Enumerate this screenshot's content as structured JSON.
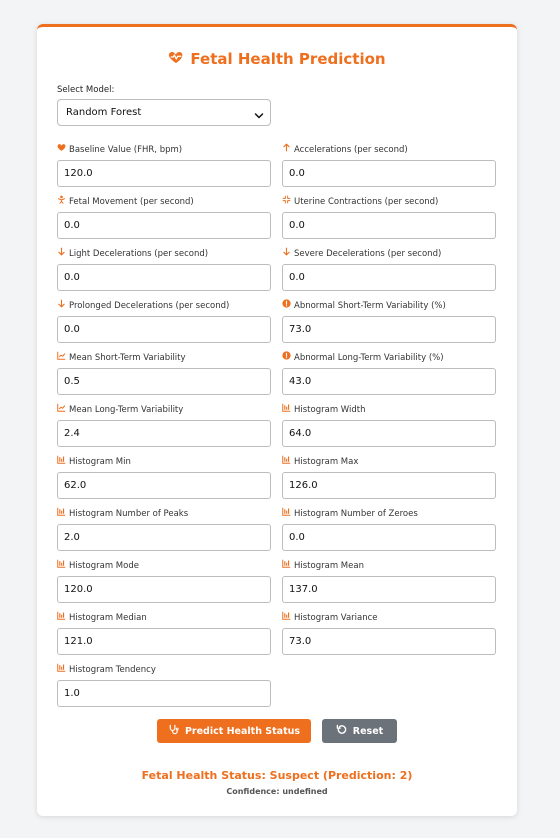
{
  "header": {
    "title": "Fetal Health Prediction"
  },
  "model": {
    "label": "Select Model:",
    "value": "Random Forest"
  },
  "fields": [
    {
      "label": "Baseline Value (FHR, bpm)",
      "value": "120.0",
      "icon": "heart-icon"
    },
    {
      "label": "Accelerations (per second)",
      "value": "0.0",
      "icon": "arrow-up-icon"
    },
    {
      "label": "Fetal Movement (per second)",
      "value": "0.0",
      "icon": "baby-icon"
    },
    {
      "label": "Uterine Contractions (per second)",
      "value": "0.0",
      "icon": "compress-icon"
    },
    {
      "label": "Light Decelerations (per second)",
      "value": "0.0",
      "icon": "arrow-down-icon"
    },
    {
      "label": "Severe Decelerations (per second)",
      "value": "0.0",
      "icon": "arrow-down-icon"
    },
    {
      "label": "Prolonged Decelerations (per second)",
      "value": "0.0",
      "icon": "arrow-down-icon"
    },
    {
      "label": "Abnormal Short-Term Variability (%)",
      "value": "73.0",
      "icon": "alert-circle-icon"
    },
    {
      "label": "Mean Short-Term Variability",
      "value": "0.5",
      "icon": "line-chart-icon"
    },
    {
      "label": "Abnormal Long-Term Variability (%)",
      "value": "43.0",
      "icon": "alert-circle-icon"
    },
    {
      "label": "Mean Long-Term Variability",
      "value": "2.4",
      "icon": "line-chart-icon"
    },
    {
      "label": "Histogram Width",
      "value": "64.0",
      "icon": "bar-chart-icon"
    },
    {
      "label": "Histogram Min",
      "value": "62.0",
      "icon": "bar-chart-icon"
    },
    {
      "label": "Histogram Max",
      "value": "126.0",
      "icon": "bar-chart-icon"
    },
    {
      "label": "Histogram Number of Peaks",
      "value": "2.0",
      "icon": "bar-chart-icon"
    },
    {
      "label": "Histogram Number of Zeroes",
      "value": "0.0",
      "icon": "bar-chart-icon"
    },
    {
      "label": "Histogram Mode",
      "value": "120.0",
      "icon": "bar-chart-icon"
    },
    {
      "label": "Histogram Mean",
      "value": "137.0",
      "icon": "bar-chart-icon"
    },
    {
      "label": "Histogram Median",
      "value": "121.0",
      "icon": "bar-chart-icon"
    },
    {
      "label": "Histogram Variance",
      "value": "73.0",
      "icon": "bar-chart-icon"
    },
    {
      "label": "Histogram Tendency",
      "value": "1.0",
      "icon": "bar-chart-icon"
    }
  ],
  "actions": {
    "predict_label": "Predict Health Status",
    "reset_label": "Reset"
  },
  "result": {
    "status": "Fetal Health Status: Suspect (Prediction: 2)",
    "confidence": "Confidence: undefined"
  },
  "colors": {
    "accent": "#ee6f1e",
    "secondary_button": "#6b727a"
  }
}
